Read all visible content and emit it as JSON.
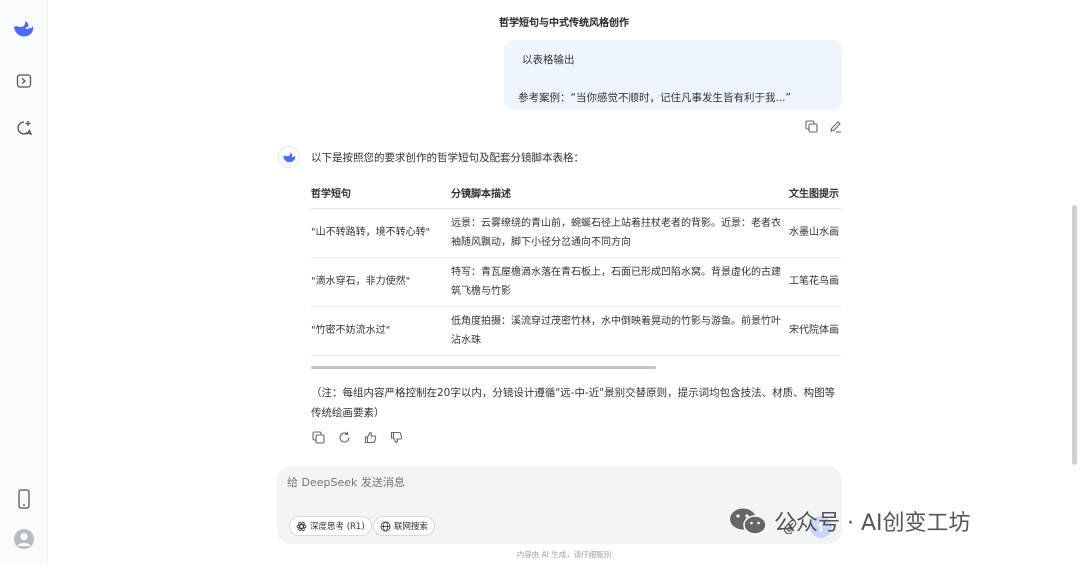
{
  "header": {
    "title": "哲学短句与中式传统风格创作"
  },
  "user_message": {
    "line1": "以表格输出",
    "line2": "参考案例：“当你感觉不顺时，记住凡事发生皆有利于我...”"
  },
  "assistant": {
    "intro": "以下是按照您的要求创作的哲学短句及配套分镜脚本表格：",
    "table": {
      "headers": [
        "哲学短句",
        "分镜脚本描述",
        "文生图提示"
      ],
      "rows": [
        {
          "phrase": "\"山不转路转，境不转心转\"",
          "script": "远景：云雾缭绕的青山前，蜿蜒石径上站着拄杖老者的背影。近景：老者衣袖随风飘动，脚下小径分岔通向不同方向",
          "prompt": "水墨山水画 皴，题跋印"
        },
        {
          "phrase": "\"滴水穿石，非力使然\"",
          "script": "特写：青瓦屋檐滴水落在青石板上，石面已形成凹陷水窝。背景虚化的古建筑飞檐与竹影",
          "prompt": "工笔花鸟画 感，朱砂题"
        },
        {
          "phrase": "\"竹密不妨流水过\"",
          "script": "低角度拍摄：溪流穿过茂密竹林，水中倒映着晃动的竹影与游鱼。前景竹叶沾水珠",
          "prompt": "宋代院体画 细节，空间"
        }
      ]
    },
    "note": "（注：每组内容严格控制在20字以内，分镜设计遵循\"远-中-近\"景别交替原则，提示词均包含技法、材质、构图等传统绘画要素）"
  },
  "composer": {
    "placeholder": "给 DeepSeek 发送消息",
    "deep_think_label": "深度思考 (R1)",
    "web_search_label": "联网搜索"
  },
  "footer": {
    "note": "内容由 AI 生成，请仔细甄别"
  },
  "watermark": {
    "text": "公众号 · AI创变工坊"
  },
  "colors": {
    "brand": "#4d6bfe",
    "bubble": "#eef5ff"
  },
  "icons": {
    "rail": [
      "deepseek-logo-icon",
      "sidebar-toggle-icon",
      "new-chat-icon",
      "phone-icon",
      "user-avatar-icon"
    ],
    "message_actions": [
      "copy-icon",
      "edit-icon",
      "regenerate-icon",
      "thumbs-up-icon",
      "thumbs-down-icon"
    ]
  }
}
